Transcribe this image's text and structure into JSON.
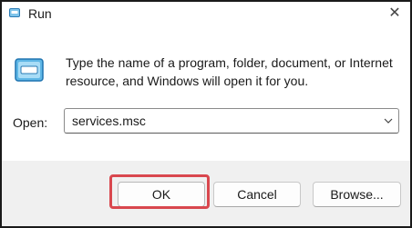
{
  "window": {
    "title": "Run",
    "close_glyph": "✕",
    "app_icon": "run-icon"
  },
  "main": {
    "description": "Type the name of a program, folder, document, or Internet resource, and Windows will open it for you.",
    "open_label": "Open:",
    "open_value": "services.msc"
  },
  "buttons": {
    "ok": "OK",
    "cancel": "Cancel",
    "browse": "Browse..."
  },
  "highlight_color": "#d9474e"
}
